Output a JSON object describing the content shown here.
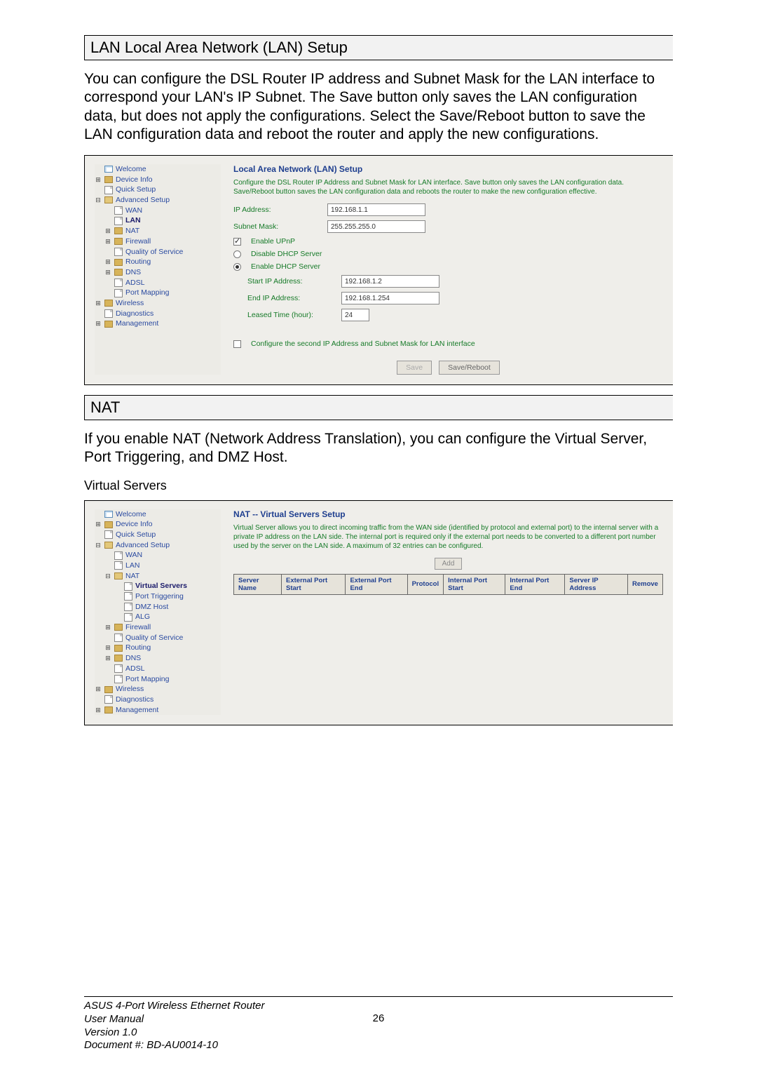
{
  "section_lan_title": "LAN Local Area Network (LAN) Setup",
  "section_lan_body": "You can configure the DSL Router IP address and Subnet Mask for the LAN interface to correspond your LAN's IP Subnet. The Save button only saves the LAN configuration data, but does not apply the configurations.  Select the Save/Reboot button to save the LAN configuration data and reboot the router and apply the new configurations.",
  "nav": {
    "welcome": "Welcome",
    "device_info": "Device Info",
    "quick_setup": "Quick Setup",
    "advanced_setup": "Advanced Setup",
    "wan": "WAN",
    "lan": "LAN",
    "nat": "NAT",
    "virtual_servers": "Virtual Servers",
    "port_triggering": "Port Triggering",
    "dmz_host": "DMZ Host",
    "alg": "ALG",
    "firewall": "Firewall",
    "qos": "Quality of Service",
    "routing": "Routing",
    "dns": "DNS",
    "adsl": "ADSL",
    "port_mapping": "Port Mapping",
    "wireless": "Wireless",
    "diagnostics": "Diagnostics",
    "management": "Management"
  },
  "lan_panel": {
    "title": "Local Area Network (LAN) Setup",
    "desc": "Configure the DSL Router IP Address and Subnet Mask for LAN interface.  Save button only saves the LAN configuration data.  Save/Reboot button saves the LAN configuration data and reboots the router to make the new configuration effective.",
    "ip_label": "IP Address:",
    "ip_value": "192.168.1.1",
    "mask_label": "Subnet Mask:",
    "mask_value": "255.255.255.0",
    "upnp_label": "Enable UPnP",
    "dhcp_disable": "Disable DHCP Server",
    "dhcp_enable": "Enable DHCP Server",
    "start_ip_label": "Start IP Address:",
    "start_ip_value": "192.168.1.2",
    "end_ip_label": "End IP Address:",
    "end_ip_value": "192.168.1.254",
    "lease_label": "Leased Time (hour):",
    "lease_value": "24",
    "second_ip": "Configure the second IP Address and Subnet Mask for LAN interface",
    "save": "Save",
    "save_reboot": "Save/Reboot"
  },
  "section_nat_title": "NAT",
  "section_nat_body": "If you enable NAT (Network Address Translation), you can configure the Virtual Server, Port Triggering, and DMZ Host.",
  "vs_heading": "Virtual Servers",
  "vs_panel": {
    "title": "NAT -- Virtual Servers Setup",
    "desc": "Virtual Server allows you to direct incoming traffic from the WAN side (identified by protocol and external port) to the internal server with a private IP address on the LAN side. The internal port is required only if the external port needs to be converted to a different port number used by the server on the LAN side. A maximum of 32 entries can be configured.",
    "add": "Add",
    "cols": {
      "server_name": "Server Name",
      "ext_start": "External Port Start",
      "ext_end": "External Port End",
      "protocol": "Protocol",
      "int_start": "Internal Port Start",
      "int_end": "Internal Port End",
      "server_ip": "Server IP Address",
      "remove": "Remove"
    }
  },
  "nav_glyph_plus": "⊞",
  "nav_glyph_minus": "⊟",
  "footer": {
    "l1": "ASUS 4-Port Wireless Ethernet Router",
    "l2": "User Manual",
    "l3": "Version 1.0",
    "l4": "Document #:  BD-AU0014-10",
    "page": "26"
  }
}
